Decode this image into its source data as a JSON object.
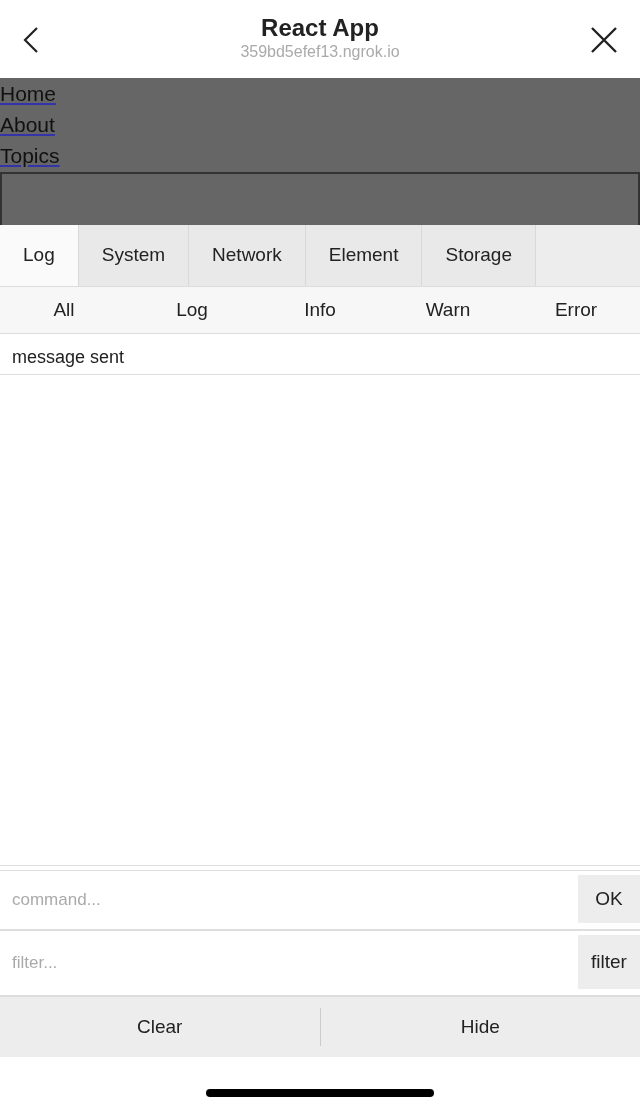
{
  "header": {
    "title": "React App",
    "url": "359bd5efef13.ngrok.io"
  },
  "nav_links": [
    "Home",
    "About",
    "Topics"
  ],
  "tabs": [
    {
      "label": "Log",
      "selected": true
    },
    {
      "label": "System",
      "selected": false
    },
    {
      "label": "Network",
      "selected": false
    },
    {
      "label": "Element",
      "selected": false
    },
    {
      "label": "Storage",
      "selected": false
    }
  ],
  "log_filters": [
    "All",
    "Log",
    "Info",
    "Warn",
    "Error"
  ],
  "log_entries": [
    "message sent"
  ],
  "command": {
    "placeholder": "command...",
    "button": "OK"
  },
  "filter": {
    "placeholder": "filter...",
    "button": "filter"
  },
  "footer_buttons": [
    "Clear",
    "Hide"
  ]
}
